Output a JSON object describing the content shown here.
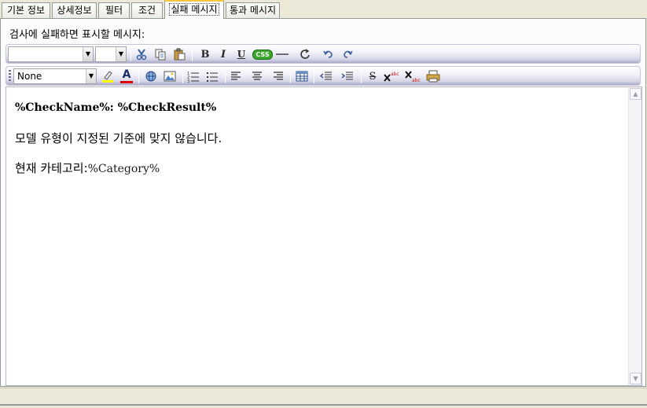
{
  "tabs": [
    {
      "label": "기본 정보"
    },
    {
      "label": "상세정보"
    },
    {
      "label": "필터"
    },
    {
      "label": "조건"
    },
    {
      "label": "실패 메시지"
    },
    {
      "label": "통과 메시지"
    }
  ],
  "active_tab": "실패 메시지",
  "prompt_label": "검사에 실패하면 표시할 메시지:",
  "toolbar1": {
    "font_family_value": "",
    "font_size_value": "",
    "icons": [
      "cut-icon",
      "copy-icon",
      "paste-icon",
      "bold-icon",
      "italic-icon",
      "underline-icon",
      "css-icon",
      "horizontal-rule-icon",
      "refresh-icon",
      "undo-icon",
      "redo-icon"
    ],
    "bold_glyph": "B",
    "italic_glyph": "I",
    "underline_glyph": "U",
    "css_glyph": "CSS"
  },
  "toolbar2": {
    "style_value": "None",
    "icons": [
      "highlight-icon",
      "font-color-icon",
      "hyperlink-icon",
      "image-icon",
      "ordered-list-icon",
      "unordered-list-icon",
      "align-left-icon",
      "align-center-icon",
      "align-right-icon",
      "table-icon",
      "outdent-icon",
      "indent-icon",
      "strikethrough-icon",
      "superscript-icon",
      "subscript-icon",
      "print-icon"
    ],
    "font_color_glyph": "A",
    "strike_glyph": "S"
  },
  "editor": {
    "line1": "%CheckName%: %CheckResult%",
    "line2": "모델 유형이 지정된 기준에 맞지 않습니다.",
    "line3_prefix": "현재 카테고리:",
    "line3_var": "%Category%"
  },
  "colors": {
    "active_tab_accent": "#ffc83c",
    "toolbar_gradient_bottom": "#a9a9c8",
    "window_background": "#ece9d8"
  }
}
